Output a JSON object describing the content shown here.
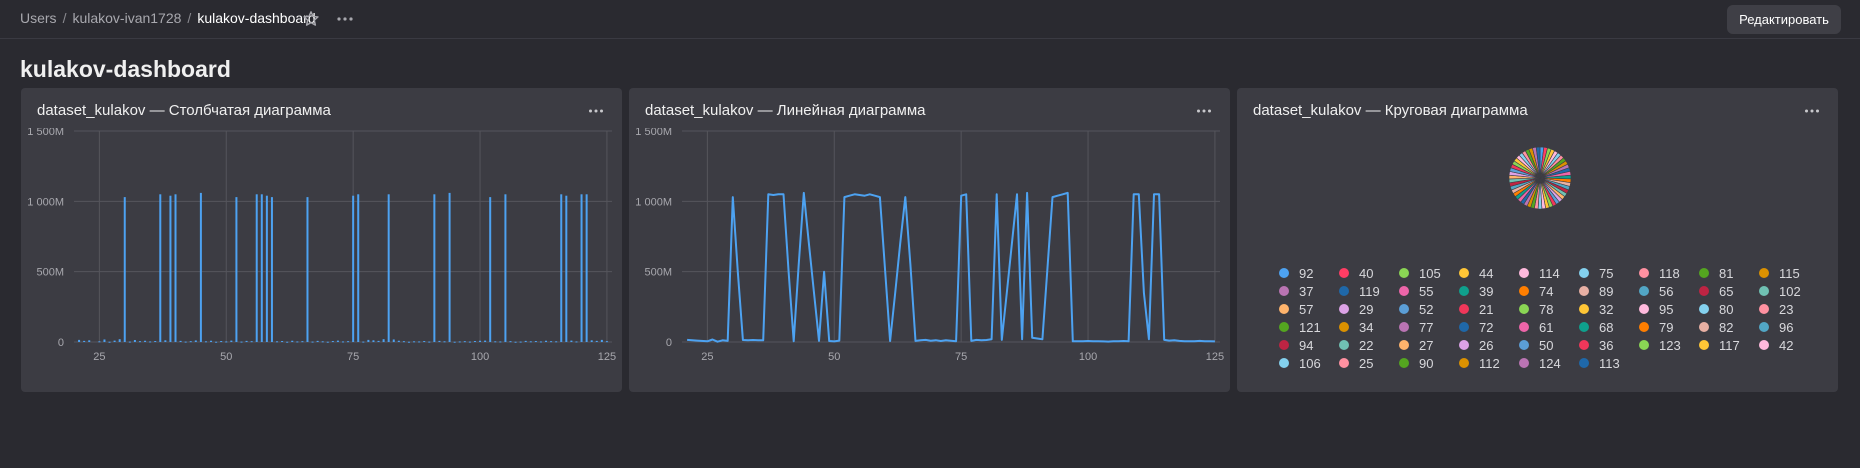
{
  "header": {
    "breadcrumb": [
      "Users",
      "kulakov-ivan1728",
      "kulakov-dashboard"
    ],
    "separator": "/",
    "edit_label": "Редактировать"
  },
  "page": {
    "title": "kulakov-dashboard"
  },
  "widgets": [
    {
      "title": "dataset_kulakov — Столбчатая диаграмма"
    },
    {
      "title": "dataset_kulakov — Линейная диаграмма"
    },
    {
      "title": "dataset_kulakov — Круговая диаграмма"
    }
  ],
  "chart_data": [
    {
      "type": "bar",
      "title": "dataset_kulakov — Столбчатая диаграмма",
      "xlim": [
        20,
        126
      ],
      "ylim": [
        0,
        1500000000
      ],
      "x_ticks": [
        25,
        50,
        75,
        100,
        125
      ],
      "y_ticks": [
        "0",
        "500M",
        "1 000M",
        "1 500M"
      ],
      "grid": true,
      "color": "#4da2f1",
      "x": [
        21,
        22,
        23,
        25,
        26,
        27,
        28,
        29,
        30,
        31,
        32,
        33,
        34,
        35,
        36,
        37,
        38,
        39,
        40,
        41,
        42,
        43,
        44,
        45,
        46,
        47,
        48,
        49,
        50,
        51,
        52,
        53,
        54,
        55,
        56,
        57,
        58,
        59,
        60,
        61,
        62,
        63,
        64,
        65,
        66,
        67,
        68,
        69,
        70,
        71,
        72,
        73,
        74,
        75,
        76,
        77,
        78,
        79,
        80,
        81,
        82,
        83,
        84,
        85,
        86,
        87,
        88,
        89,
        90,
        91,
        92,
        93,
        94,
        95,
        96,
        97,
        98,
        99,
        100,
        101,
        102,
        103,
        104,
        105,
        106,
        107,
        108,
        109,
        110,
        111,
        112,
        113,
        114,
        115,
        116,
        117,
        118,
        119,
        120,
        121,
        122,
        123,
        124,
        125
      ],
      "values": [
        15000000,
        8000000,
        12000000,
        5000000,
        18000000,
        2000000,
        10000000,
        20000000,
        1030000000,
        3000000,
        14000000,
        6000000,
        9000000,
        4000000,
        7000000,
        1050000000,
        12000000,
        1040000000,
        1050000000,
        8000000,
        3000000,
        6000000,
        11000000,
        1060000000,
        5000000,
        9000000,
        2000000,
        7000000,
        4000000,
        10000000,
        1030000000,
        3000000,
        8000000,
        6000000,
        1050000000,
        1050000000,
        1040000000,
        1030000000,
        5000000,
        7000000,
        2000000,
        9000000,
        4000000,
        6000000,
        1030000000,
        3000000,
        8000000,
        5000000,
        2000000,
        7000000,
        10000000,
        4000000,
        6000000,
        1040000000,
        1050000000,
        3000000,
        15000000,
        12000000,
        8000000,
        20000000,
        1050000000,
        18000000,
        9000000,
        6000000,
        2000000,
        5000000,
        4000000,
        7000000,
        3000000,
        1050000000,
        8000000,
        5000000,
        1060000000,
        2000000,
        4000000,
        6000000,
        3000000,
        7000000,
        9000000,
        10000000,
        1030000000,
        5000000,
        4000000,
        1050000000,
        6000000,
        2000000,
        3000000,
        8000000,
        5000000,
        7000000,
        4000000,
        9000000,
        6000000,
        5000000,
        1050000000,
        1040000000,
        10000000,
        4000000,
        1050000000,
        1050000000,
        12000000,
        8000000,
        15000000,
        6000000
      ]
    },
    {
      "type": "line",
      "title": "dataset_kulakov — Линейная диаграмма",
      "xlim": [
        20,
        126
      ],
      "ylim": [
        0,
        1500000000
      ],
      "x_ticks": [
        25,
        50,
        75,
        100,
        125
      ],
      "y_ticks": [
        "0",
        "500M",
        "1 000M",
        "1 500M"
      ],
      "grid": true,
      "color": "#4da2f1",
      "x": [
        21,
        22,
        23,
        25,
        26,
        27,
        28,
        29,
        30,
        31,
        32,
        33,
        34,
        35,
        36,
        37,
        38,
        39,
        40,
        41,
        42,
        43,
        44,
        45,
        46,
        47,
        48,
        49,
        50,
        51,
        52,
        53,
        54,
        55,
        56,
        57,
        58,
        59,
        60,
        61,
        62,
        63,
        64,
        65,
        66,
        67,
        68,
        69,
        70,
        71,
        72,
        73,
        74,
        75,
        76,
        77,
        78,
        79,
        80,
        81,
        82,
        83,
        84,
        85,
        86,
        87,
        88,
        89,
        90,
        91,
        92,
        93,
        94,
        95,
        96,
        97,
        98,
        99,
        100,
        101,
        102,
        103,
        104,
        105,
        106,
        107,
        108,
        109,
        110,
        111,
        112,
        113,
        114,
        115,
        116,
        117,
        118,
        119,
        120,
        121,
        122,
        123,
        124,
        125
      ],
      "y": [
        15000000,
        12000000,
        10000000,
        5000000,
        18000000,
        2000000,
        12000000,
        8000000,
        1030000000,
        500000000,
        14000000,
        12000000,
        14000000,
        13000000,
        12000000,
        1050000000,
        1045000000,
        1050000000,
        1050000000,
        500000000,
        6000000,
        550000000,
        1060000000,
        700000000,
        350000000,
        8000000,
        500000000,
        7000000,
        4000000,
        10000000,
        1030000000,
        1040000000,
        1050000000,
        1045000000,
        1040000000,
        1050000000,
        1040000000,
        1030000000,
        520000000,
        7000000,
        350000000,
        700000000,
        1030000000,
        550000000,
        8000000,
        12000000,
        15000000,
        9000000,
        13000000,
        7000000,
        12000000,
        9000000,
        6000000,
        1040000000,
        1050000000,
        8000000,
        15000000,
        12000000,
        14000000,
        20000000,
        1050000000,
        15000000,
        350000000,
        700000000,
        1050000000,
        20000000,
        1060000000,
        30000000,
        25000000,
        20000000,
        520000000,
        1030000000,
        1040000000,
        1050000000,
        1060000000,
        5000000,
        6000000,
        5000000,
        7000000,
        6000000,
        5000000,
        4000000,
        3000000,
        6000000,
        5000000,
        7000000,
        5000000,
        1050000000,
        1050000000,
        350000000,
        20000000,
        1050000000,
        1050000000,
        15000000,
        10000000,
        12000000,
        8000000,
        5000000,
        6000000,
        5000000,
        8000000,
        6000000,
        5000000,
        4000000
      ]
    },
    {
      "type": "pie",
      "title": "dataset_kulakov — Круговая диаграмма",
      "legend_position": "bottom",
      "categories": [
        "92",
        "40",
        "105",
        "44",
        "114",
        "75",
        "118",
        "81",
        "115",
        "37",
        "119",
        "55",
        "39",
        "74",
        "89",
        "56",
        "65",
        "102",
        "57",
        "29",
        "52",
        "21",
        "78",
        "32",
        "95",
        "80",
        "23",
        "121",
        "34",
        "77",
        "72",
        "61",
        "68",
        "79",
        "82",
        "96",
        "94",
        "22",
        "27",
        "26",
        "50",
        "36",
        "123",
        "117",
        "42",
        "106",
        "25",
        "90",
        "112",
        "124",
        "113"
      ],
      "colors": [
        "#4da2f1",
        "#ff3d64",
        "#8ad554",
        "#ffc636",
        "#ffb9dd",
        "#84d1ee",
        "#ff91a1",
        "#54a520",
        "#db9100",
        "#ba74b3",
        "#1f68a9",
        "#ed65a9",
        "#0fa08d",
        "#ff7e00",
        "#e8b0a4",
        "#52a6c5",
        "#be2443",
        "#70c1b3",
        "#ffb46c",
        "#dca2e6",
        "#5b9ed6",
        "#f0375a",
        "#8ad554",
        "#ffc636",
        "#ffb9dd",
        "#84d1ee",
        "#ff91a1",
        "#54a520",
        "#db9100",
        "#ba74b3",
        "#1f68a9",
        "#ed65a9",
        "#0fa08d",
        "#ff7e00",
        "#e8b0a4",
        "#52a6c5",
        "#be2443",
        "#70c1b3",
        "#ffb46c",
        "#dca2e6",
        "#5b9ed6",
        "#f0375a",
        "#8ad554",
        "#ffc636",
        "#ffb9dd",
        "#84d1ee",
        "#ff91a1",
        "#54a520",
        "#db9100",
        "#ba74b3",
        "#1f68a9"
      ],
      "values": [
        1,
        1,
        1,
        1,
        1,
        1,
        1,
        1,
        1,
        1,
        1,
        1,
        1,
        1,
        1,
        1,
        1,
        1,
        1,
        1,
        1,
        1,
        1,
        1,
        1,
        1,
        1,
        1,
        1,
        1,
        1,
        1,
        1,
        1,
        1,
        1,
        1,
        1,
        1,
        1,
        1,
        1,
        1,
        1,
        1,
        1,
        1,
        1,
        1,
        1,
        1
      ]
    }
  ]
}
